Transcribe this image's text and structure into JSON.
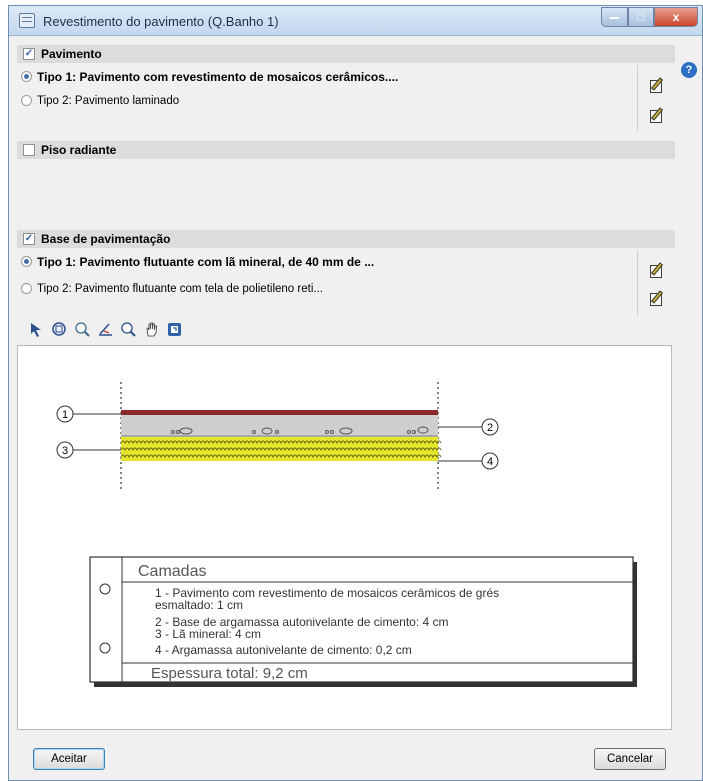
{
  "window": {
    "title": "Revestimento do pavimento (Q.Banho 1)",
    "close_glyph": "x",
    "max_glyph": "□",
    "min_glyph": ""
  },
  "help_glyph": "?",
  "sections": {
    "pavimento": {
      "label": "Pavimento",
      "checked": true,
      "options": [
        {
          "label": "Tipo 1: Pavimento com revestimento de mosaicos cerâmicos....",
          "selected": true
        },
        {
          "label": "Tipo 2: Pavimento laminado",
          "selected": false
        }
      ]
    },
    "piso_radiante": {
      "label": "Piso radiante",
      "checked": false
    },
    "base": {
      "label": "Base de pavimentação",
      "checked": true,
      "options": [
        {
          "label": "Tipo 1: Pavimento flutuante com lã mineral, de 40 mm de ...",
          "selected": true
        },
        {
          "label": "Tipo 2: Pavimento flutuante com tela de polietileno reti...",
          "selected": false
        }
      ]
    }
  },
  "check_glyph": "✓",
  "toolbar_icons": [
    "select-icon",
    "zoom-window-icon",
    "zoom-all-icon",
    "measure-icon",
    "zoom-icon",
    "pan-icon",
    "export-icon"
  ],
  "diagram": {
    "callouts": [
      "1",
      "2",
      "3",
      "4"
    ],
    "layers_title": "Camadas",
    "layers": [
      "1 - Pavimento com revestimento de mosaicos cerâmicos de grés",
      "esmaltado: 1 cm",
      "2 - Base de argamassa autonivelante de cimento: 4 cm",
      "3 - Lã mineral: 4 cm",
      "4 - Argamassa autonivelante de cimento: 0,2 cm"
    ],
    "total": "Espessura total: 9,2 cm",
    "colors": {
      "tile": "#8b2a2a",
      "screed": "#cfcfcf",
      "wool": "#e6e62e",
      "thin": "#a8a8a8"
    }
  },
  "buttons": {
    "ok": "Aceitar",
    "cancel": "Cancelar"
  }
}
